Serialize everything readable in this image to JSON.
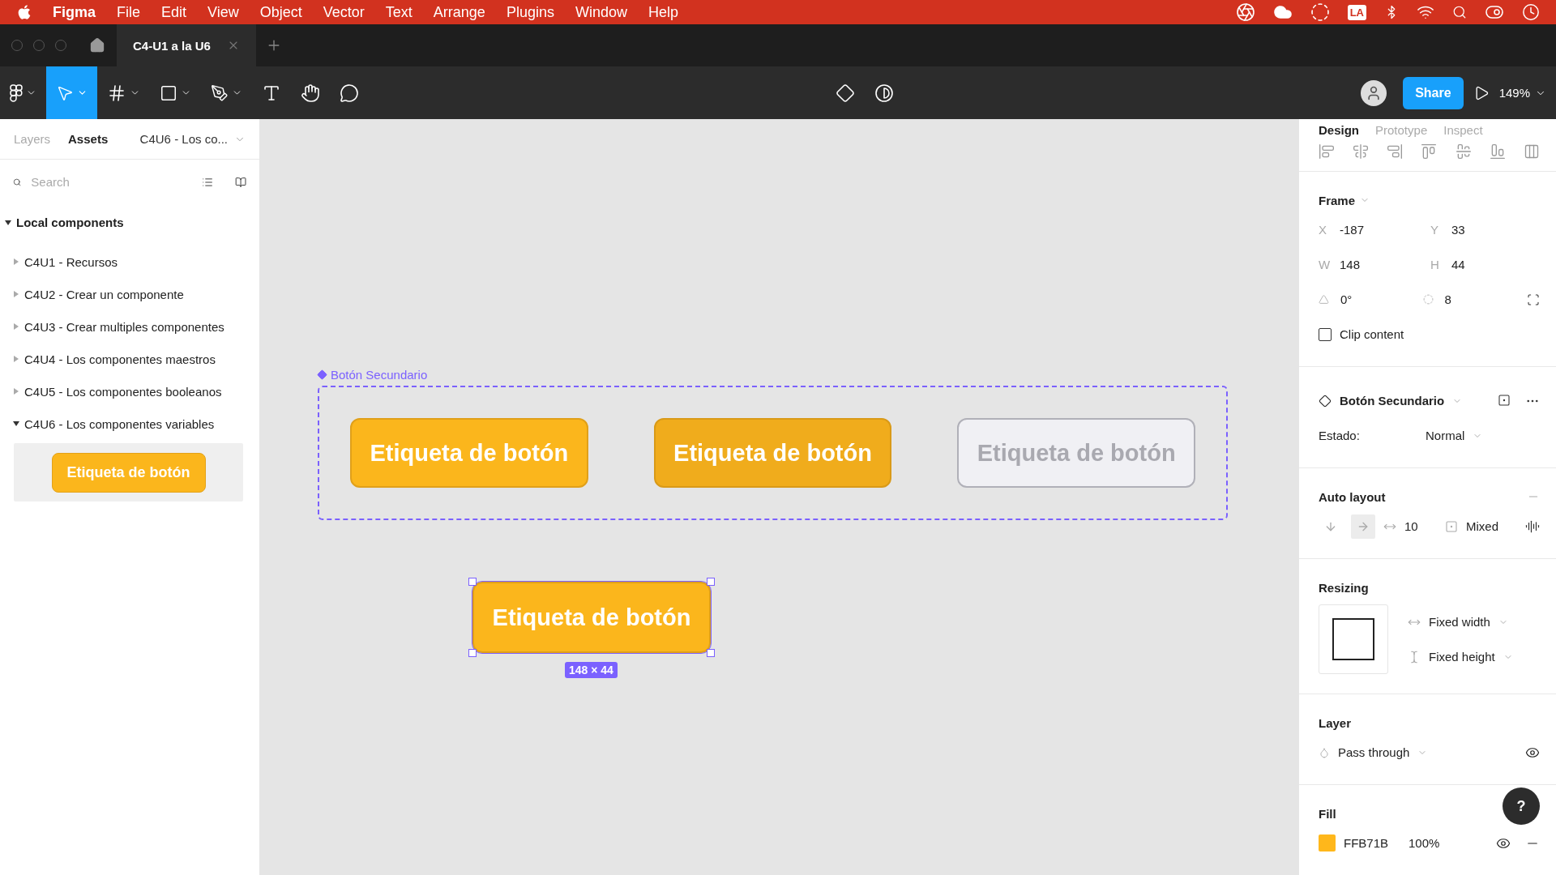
{
  "menubar": {
    "app": "Figma",
    "items": [
      "File",
      "Edit",
      "View",
      "Object",
      "Vector",
      "Text",
      "Arrange",
      "Plugins",
      "Window",
      "Help"
    ],
    "input_source": "LA"
  },
  "tabs": [
    {
      "label": "C4-U1 a la U6",
      "selected": true
    }
  ],
  "toolbar": {
    "share": "Share",
    "zoom": "149%"
  },
  "left_panel": {
    "tabs": [
      {
        "label": "Layers",
        "selected": false
      },
      {
        "label": "Assets",
        "selected": true
      }
    ],
    "page": "C4U6 - Los co...",
    "search": {
      "placeholder": "Search"
    },
    "section": {
      "label": "Local components",
      "expanded": true
    },
    "groups": [
      {
        "label": "C4U1 - Recursos",
        "expanded": false
      },
      {
        "label": "C4U2 - Crear un componente",
        "expanded": false
      },
      {
        "label": "C4U3 - Crear multiples componentes",
        "expanded": false
      },
      {
        "label": "C4U4 - Los componentes maestros",
        "expanded": false
      },
      {
        "label": "C4U5 - Los componentes booleanos",
        "expanded": false
      },
      {
        "label": "C4U6 - Los componentes variables",
        "expanded": true
      }
    ],
    "preview_button": "Etiqueta de botón"
  },
  "canvas": {
    "component_set": {
      "label": "Botón Secundario",
      "variants": [
        {
          "label": "Etiqueta de botón",
          "kind": "default"
        },
        {
          "label": "Etiqueta de botón",
          "kind": "hover"
        },
        {
          "label": "Etiqueta de botón",
          "kind": "disabled"
        }
      ]
    },
    "instance": {
      "label": "Etiqueta de botón",
      "size": "148 × 44"
    }
  },
  "right_panel": {
    "tabs": [
      {
        "label": "Design",
        "selected": true
      },
      {
        "label": "Prototype",
        "selected": false
      },
      {
        "label": "Inspect",
        "selected": false
      }
    ],
    "frame": {
      "title": "Frame",
      "fields": [
        {
          "label": "X",
          "value": "-187"
        },
        {
          "label": "Y",
          "value": "33"
        },
        {
          "label": "W",
          "value": "148"
        },
        {
          "label": "H",
          "value": "44"
        }
      ],
      "rotation": "0°",
      "radius": "8",
      "clip": {
        "label": "Clip content",
        "checked": false
      }
    },
    "component": {
      "name": "Botón Secundario",
      "property": "Estado:",
      "value": "Normal"
    },
    "auto_layout": {
      "title": "Auto layout",
      "direction_buttons": [
        {
          "kind": "vertical",
          "selected": false
        },
        {
          "kind": "horizontal",
          "selected": true
        }
      ],
      "spacing": "10",
      "padding": "Mixed"
    },
    "resizing": {
      "title": "Resizing",
      "width": "Fixed width",
      "height": "Fixed height"
    },
    "layer": {
      "title": "Layer",
      "blend": "Pass through"
    },
    "fill": {
      "title": "Fill",
      "fills": [
        {
          "color": "#ffb71b",
          "hex": "FFB71B",
          "opacity": "100%"
        }
      ]
    },
    "help": "?"
  }
}
